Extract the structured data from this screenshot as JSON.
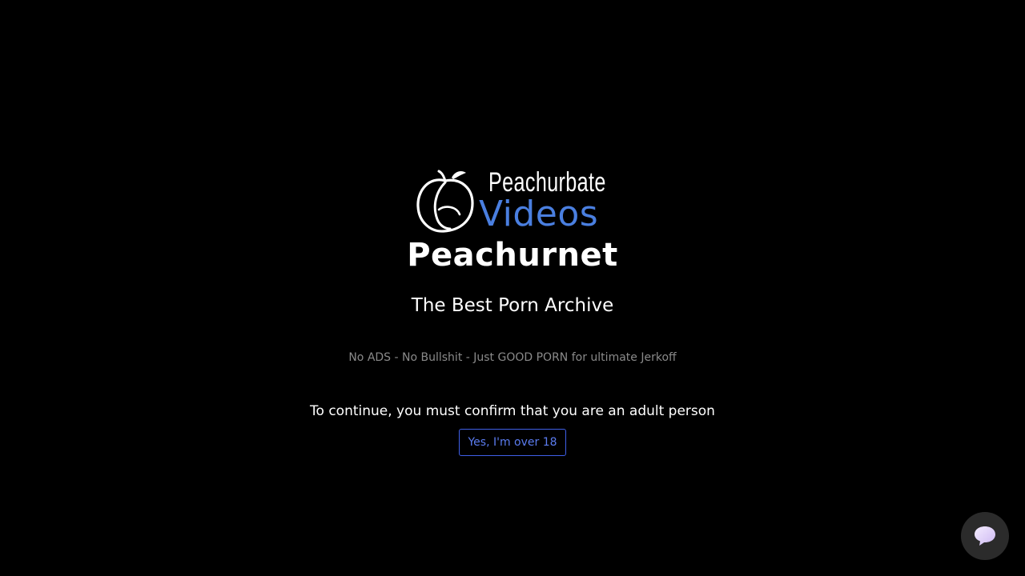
{
  "logo": {
    "line1": "Peachurbate",
    "line2": "Videos",
    "icon": "peach-icon",
    "accent_color": "#4a7fe0"
  },
  "site_name": "Peachurnet",
  "tagline": "The Best Porn Archive",
  "subtagline": "No ADS - No Bullshit - Just GOOD PORN for ultimate Jerkoff",
  "age_gate": {
    "prompt": "To continue, you must confirm that you are an adult person",
    "confirm_label": "Yes, I'm over 18",
    "button_color": "#3f5fe8"
  },
  "chat": {
    "icon": "chat-bubble-icon"
  }
}
